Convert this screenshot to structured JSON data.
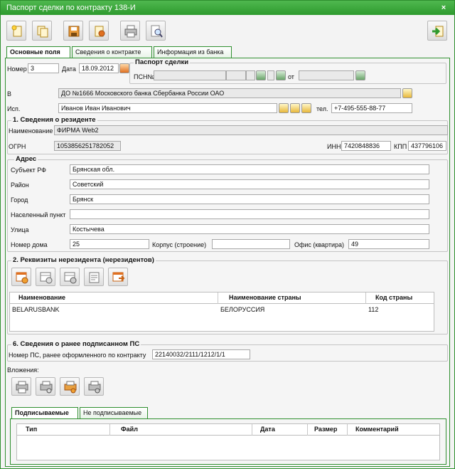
{
  "window": {
    "title": "Паспорт сделки по контракту 138-И",
    "close_glyph": "×"
  },
  "toolbar": {
    "icons": [
      "new-doc-icon",
      "copy-icon",
      "save-icon",
      "sign-icon",
      "print-icon",
      "preview-icon",
      "exit-icon"
    ]
  },
  "tabs_top": [
    {
      "label": "Основные поля",
      "active": true
    },
    {
      "label": "Сведения о контракте",
      "active": false
    },
    {
      "label": "Информация из банка",
      "active": false
    }
  ],
  "main": {
    "number_label": "Номер",
    "number_value": "3",
    "date_label": "Дата",
    "date_value": "18.09.2012",
    "passport_group_title": "Паспорт сделки",
    "psn_label": "ПСН№",
    "ot_label": "от",
    "bank_label": "В",
    "bank_value": "ДО №1666 Московского банка Сбербанка России ОАО",
    "executor_label": "Исп.",
    "executor_value": "Иванов Иван Иванович",
    "phone_label": "тел.",
    "phone_value": "+7-495-555-88-77"
  },
  "resident": {
    "section_title": "1. Сведения о резиденте",
    "name_label": "Наименование",
    "name_value": "ФИРМА Web2",
    "ogrn_label": "ОГРН",
    "ogrn_value": "1053856251782052",
    "inn_label": "ИНН",
    "inn_value": "7420848836",
    "kpp_label": "КПП",
    "kpp_value": "437796106"
  },
  "address": {
    "group_title": "Адрес",
    "region_label": "Субъект РФ",
    "region_value": "Брянская обл.",
    "district_label": "Район",
    "district_value": "Советский",
    "city_label": "Город",
    "city_value": "Брянск",
    "locality_label": "Населенный пункт",
    "locality_value": "",
    "street_label": "Улица",
    "street_value": "Костычева",
    "house_label": "Номер дома",
    "house_value": "25",
    "building_label": "Корпус (строение)",
    "building_value": "",
    "office_label": "Офис (квартира)",
    "office_value": "49"
  },
  "nonresident": {
    "section_title": "2. Реквизиты нерезидента (нерезидентов)",
    "icons": [
      "add-row-icon",
      "edit-row-icon",
      "delete-row-icon",
      "notes-icon",
      "import-icon"
    ],
    "columns": [
      "Наименование",
      "Наименование страны",
      "Код страны"
    ],
    "rows": [
      {
        "name": "BELARUSBANK",
        "country": "БЕЛОРУССИЯ",
        "code": "112"
      }
    ]
  },
  "previous_ps": {
    "section_title": "6. Сведения о ранее подписанном ПС",
    "label": "Номер ПС, ранее оформленного по контракту",
    "value": "22140032/2111/1212/1/1"
  },
  "attachments": {
    "label": "Вложения:",
    "icons": [
      "attach-add-icon",
      "attach-scan-icon",
      "attach-edit-icon",
      "attach-delete-icon"
    ],
    "tabs": [
      {
        "label": "Подписываемые",
        "active": true
      },
      {
        "label": "Не подписываемые",
        "active": false
      }
    ],
    "columns": [
      "Тип",
      "Файл",
      "Дата",
      "Размер",
      "Комментарий"
    ]
  },
  "colors": {
    "accent": "#2e9a2e",
    "border_green": "#2f8f2f",
    "panel_bg": "#f5f5f5"
  }
}
